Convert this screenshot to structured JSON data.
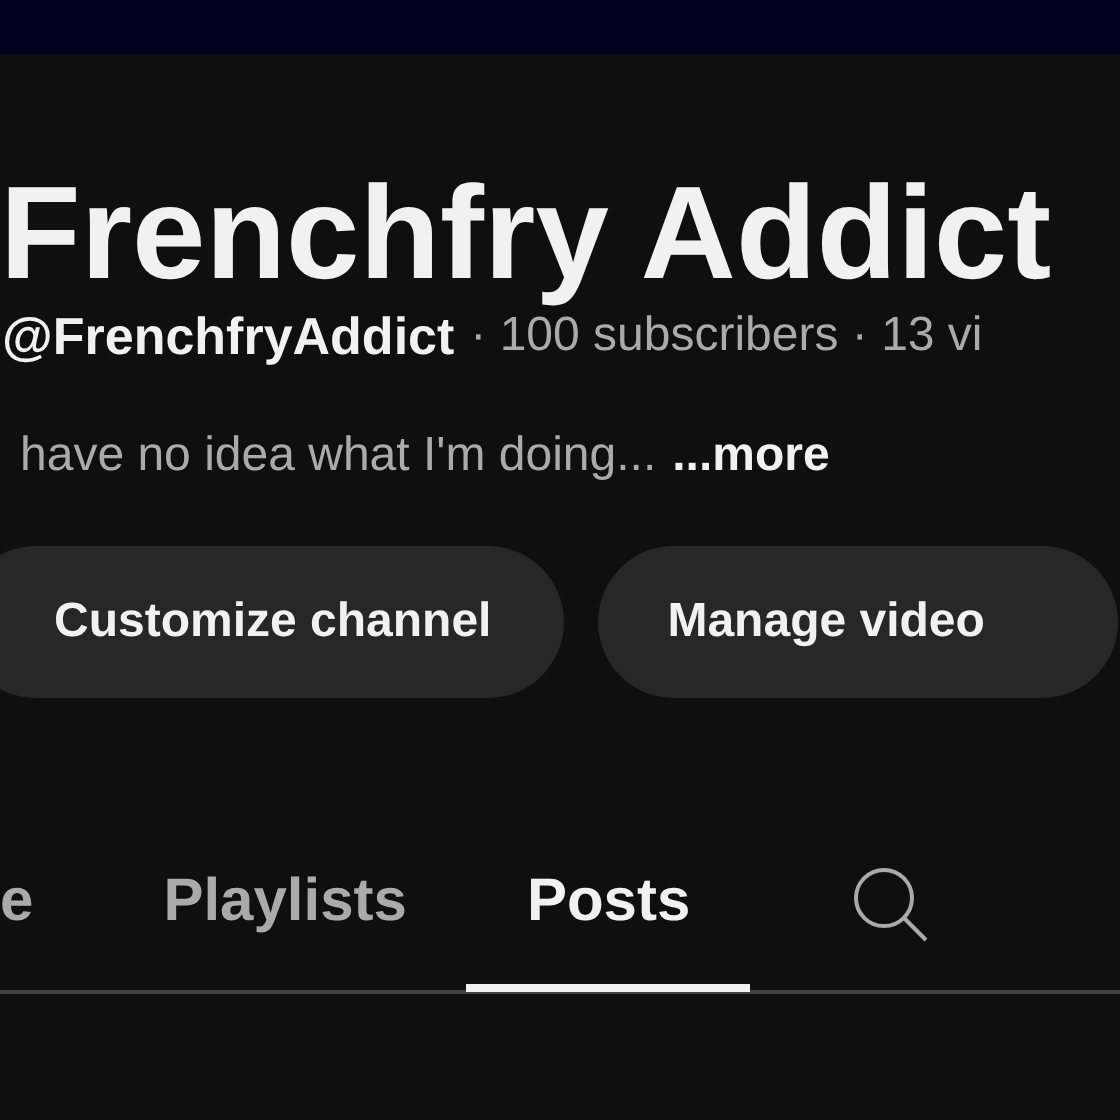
{
  "channel": {
    "name": "Frenchfry Addict",
    "handle": "@FrenchfryAddict",
    "meta": "· 100 subscribers · 13 vi",
    "description": "have no idea what I'm doing...",
    "more_link": "...more"
  },
  "buttons": [
    "Customize channel",
    "Manage video"
  ],
  "tabs": [
    {
      "label": "e",
      "selected": false
    },
    {
      "label": "Playlists",
      "selected": false
    },
    {
      "label": "Posts",
      "selected": true
    }
  ]
}
